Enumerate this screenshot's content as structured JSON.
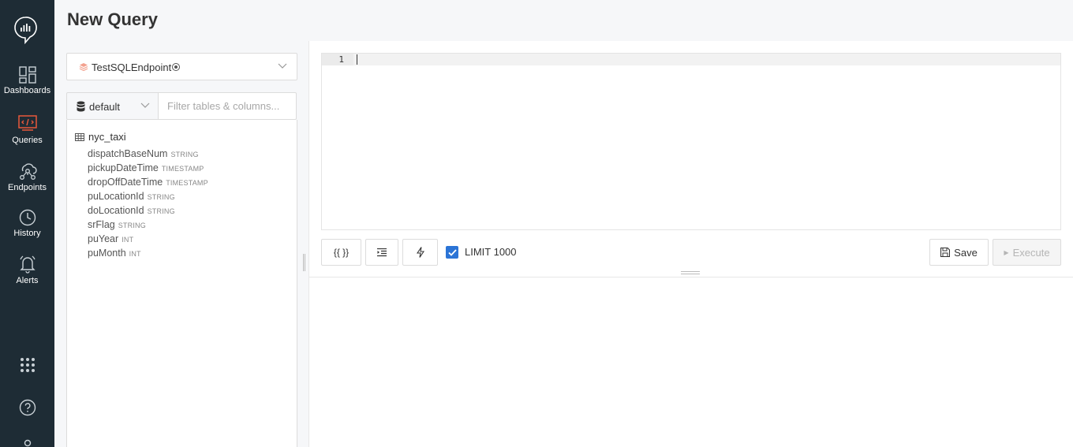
{
  "page": {
    "title": "New Query"
  },
  "sidebar": {
    "items": [
      {
        "label": "Dashboards",
        "icon": "dashboards-icon"
      },
      {
        "label": "Queries",
        "icon": "queries-icon",
        "active": true
      },
      {
        "label": "Endpoints",
        "icon": "endpoints-icon"
      },
      {
        "label": "History",
        "icon": "history-icon"
      },
      {
        "label": "Alerts",
        "icon": "alerts-icon"
      }
    ],
    "active_color": "#e8583b"
  },
  "schema": {
    "endpoint": "TestSQLEndpoint",
    "database": "default",
    "filter_placeholder": "Filter tables & columns...",
    "table": "nyc_taxi",
    "columns": [
      {
        "name": "dispatchBaseNum",
        "type": "STRING"
      },
      {
        "name": "pickupDateTime",
        "type": "TIMESTAMP"
      },
      {
        "name": "dropOffDateTime",
        "type": "TIMESTAMP"
      },
      {
        "name": "puLocationId",
        "type": "STRING"
      },
      {
        "name": "doLocationId",
        "type": "STRING"
      },
      {
        "name": "srFlag",
        "type": "STRING"
      },
      {
        "name": "puYear",
        "type": "INT"
      },
      {
        "name": "puMonth",
        "type": "INT"
      }
    ]
  },
  "editor": {
    "line_number": "1"
  },
  "toolbar": {
    "params_label": "{{ }}",
    "limit_checked": true,
    "limit_label": "LIMIT 1000",
    "save_label": "Save",
    "execute_label": "Execute",
    "accent": "#2b74d6"
  }
}
